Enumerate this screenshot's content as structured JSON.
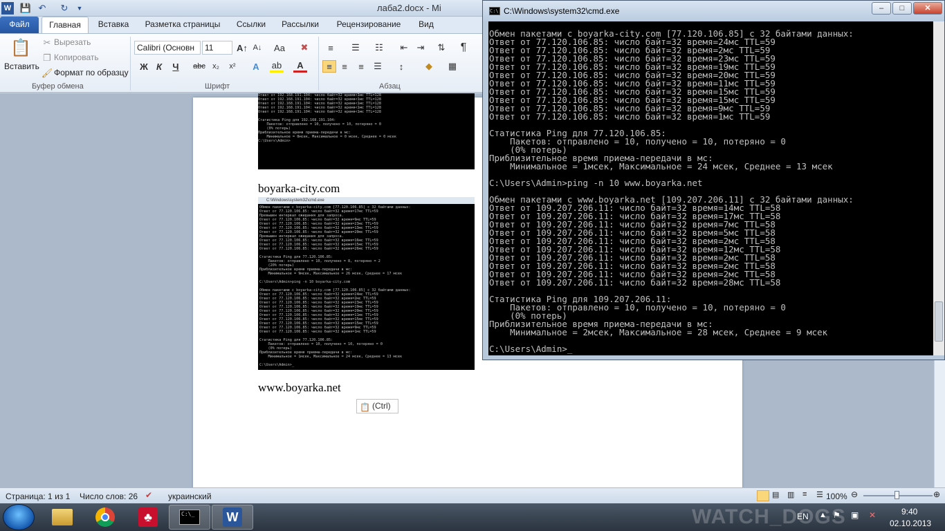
{
  "word": {
    "doc_title": "лаба2.docx - Mi",
    "tabs": [
      "Файл",
      "Главная",
      "Вставка",
      "Разметка страницы",
      "Ссылки",
      "Рассылки",
      "Рецензирование",
      "Вид"
    ],
    "active_tab": "Главная",
    "clipboard": {
      "paste": "Вставить",
      "cut": "Вырезать",
      "copy": "Копировать",
      "format_painter": "Формат по образцу",
      "group": "Буфер обмена"
    },
    "font": {
      "name": "Calibri (Основн",
      "size": "11",
      "group": "Шрифт"
    },
    "paragraph": {
      "group": "Абзац"
    },
    "doc_lines": {
      "site1": "boyarka-city.com",
      "site2": "www.boyarka.net"
    },
    "paste_options": "(Ctrl)",
    "thumb_top": [
      "Ответ от 192.168.191.104: число байт=32 время<1мс TTL=128",
      "Ответ от 192.168.191.104: число байт=32 время<1мс TTL=128",
      "Ответ от 192.168.191.104: число байт=32 время<1мс TTL=128",
      "Ответ от 192.168.191.104: число байт=32 время<1мс TTL=128",
      "Ответ от 192.168.191.104: число байт=32 время<1мс TTL=128",
      "",
      "Статистика Ping для 192.168.191.104:",
      "    Пакетов: отправлено = 10, получено = 10, потеряно = 0",
      "    (0% потерь)",
      "Приблизительное время приема-передачи в мс:",
      "    Минимальное = 0мсек, Максимальное = 0 мсек, Среднее = 0 мсек",
      "C:\\Users\\Admin>"
    ],
    "thumb_main_title": "C:\\Windows\\system32\\cmd.exe",
    "thumb_main": [
      "Обмен пакетами с boyarka-city.com [77.120.106.85] с 32 байтами данных:",
      "Ответ от 77.120.106.85: число байт=32 время=17мс TTL=59",
      "Превышен интервал ожидания для запроса.",
      "Ответ от 77.120.106.85: число байт=32 время=9мс TTL=59",
      "Ответ от 77.120.106.85: число байт=32 время=23мс TTL=59",
      "Ответ от 77.120.106.85: число байт=32 время=13мс TTL=59",
      "Ответ от 77.120.106.85: число байт=32 время=20мс TTL=59",
      "Превышен интервал ожидания для запроса.",
      "Ответ от 77.120.106.85: число байт=32 время=16мс TTL=59",
      "Ответ от 77.120.106.85: число байт=32 время=15мс TTL=59",
      "Ответ от 77.120.106.85: число байт=32 время=26мс TTL=59",
      "",
      "Статистика Ping для 77.120.106.85:",
      "    Пакетов: отправлено = 10, получено = 8, потеряно = 2",
      "    (20% потерь)",
      "Приблизительное время приема-передачи в мс:",
      "    Минимальное = 9мсек, Максимальное = 26 мсек, Среднее = 17 мсек",
      "",
      "C:\\Users\\Admin>ping -n 10 boyarka-city.com",
      "",
      "Обмен пакетами с boyarka-city.com [77.120.106.85] с 32 байтами данных:",
      "Ответ от 77.120.106.85: число байт=32 время=24мс TTL=59",
      "Ответ от 77.120.106.85: число байт=32 время=2мс TTL=59",
      "Ответ от 77.120.106.85: число байт=32 время=23мс TTL=59",
      "Ответ от 77.120.106.85: число байт=32 время=19мс TTL=59",
      "Ответ от 77.120.106.85: число байт=32 время=20мс TTL=59",
      "Ответ от 77.120.106.85: число байт=32 время=11мс TTL=59",
      "Ответ от 77.120.106.85: число байт=32 время=15мс TTL=59",
      "Ответ от 77.120.106.85: число байт=32 время=15мс TTL=59",
      "Ответ от 77.120.106.85: число байт=32 время=9мс TTL=59",
      "Ответ от 77.120.106.85: число байт=32 время=1мс TTL=59",
      "",
      "Статистика Ping для 77.120.106.85:",
      "    Пакетов: отправлено = 10, получено = 10, потеряно = 0",
      "    (0% потерь)",
      "Приблизительное время приема-передачи в мс:",
      "    Минимальное = 1мсек, Максимальное = 24 мсек, Среднее = 13 мсек",
      "",
      "C:\\Users\\Admin>_"
    ],
    "status": {
      "page": "Страница: 1 из 1",
      "words": "Число слов: 26",
      "language": "украинский",
      "zoom": "100%"
    }
  },
  "cmd": {
    "title": "C:\\Windows\\system32\\cmd.exe",
    "lines": [
      "Обмен пакетами с boyarka-city.com [77.120.106.85] с 32 байтами данных:",
      "Ответ от 77.120.106.85: число байт=32 время=24мс TTL=59",
      "Ответ от 77.120.106.85: число байт=32 время=2мс TTL=59",
      "Ответ от 77.120.106.85: число байт=32 время=23мс TTL=59",
      "Ответ от 77.120.106.85: число байт=32 время=19мс TTL=59",
      "Ответ от 77.120.106.85: число байт=32 время=20мс TTL=59",
      "Ответ от 77.120.106.85: число байт=32 время=11мс TTL=59",
      "Ответ от 77.120.106.85: число байт=32 время=15мс TTL=59",
      "Ответ от 77.120.106.85: число байт=32 время=15мс TTL=59",
      "Ответ от 77.120.106.85: число байт=32 время=9мс TTL=59",
      "Ответ от 77.120.106.85: число байт=32 время=1мс TTL=59",
      "",
      "Статистика Ping для 77.120.106.85:",
      "    Пакетов: отправлено = 10, получено = 10, потеряно = 0",
      "    (0% потерь)",
      "Приблизительное время приема-передачи в мс:",
      "    Минимальное = 1мсек, Максимальное = 24 мсек, Среднее = 13 мсек",
      "",
      "C:\\Users\\Admin>ping -n 10 www.boyarka.net",
      "",
      "Обмен пакетами с www.boyarka.net [109.207.206.11] с 32 байтами данных:",
      "Ответ от 109.207.206.11: число байт=32 время=14мс TTL=58",
      "Ответ от 109.207.206.11: число байт=32 время=17мс TTL=58",
      "Ответ от 109.207.206.11: число байт=32 время=7мс TTL=58",
      "Ответ от 109.207.206.11: число байт=32 время=5мс TTL=58",
      "Ответ от 109.207.206.11: число байт=32 время=2мс TTL=58",
      "Ответ от 109.207.206.11: число байт=32 время=12мс TTL=58",
      "Ответ от 109.207.206.11: число байт=32 время=2мс TTL=58",
      "Ответ от 109.207.206.11: число байт=32 время=2мс TTL=58",
      "Ответ от 109.207.206.11: число байт=32 время=2мс TTL=58",
      "Ответ от 109.207.206.11: число байт=32 время=28мс TTL=58",
      "",
      "Статистика Ping для 109.207.206.11:",
      "    Пакетов: отправлено = 10, получено = 10, потеряно = 0",
      "    (0% потерь)",
      "Приблизительное время приема-передачи в мс:",
      "    Минимальное = 2мсек, Максимальное = 28 мсек, Среднее = 9 мсек",
      "",
      "C:\\Users\\Admin>_"
    ]
  },
  "taskbar": {
    "language": "EN",
    "time": "9:40",
    "date": "02.10.2013",
    "wallpaper_text": "WATCH_DOGS"
  },
  "icons": [
    "word-icon",
    "save-icon",
    "undo-icon",
    "redo-icon",
    "paste-icon",
    "cut-icon",
    "copy-icon",
    "format-painter-icon",
    "bold-icon",
    "italic-icon",
    "underline-icon",
    "strikethrough-icon",
    "subscript-icon",
    "superscript-icon",
    "bullets-icon",
    "numbering-icon",
    "align-left-icon",
    "align-center-icon",
    "align-right-icon",
    "justify-icon",
    "pilcrow-icon",
    "cmd-icon",
    "start-orb-icon",
    "explorer-icon",
    "chrome-icon",
    "acrobat-icon",
    "word-taskbar-icon"
  ],
  "colors": {
    "file_tab": "#2b579a",
    "console_bg": "#000000",
    "console_fg": "#c0c0c0"
  }
}
